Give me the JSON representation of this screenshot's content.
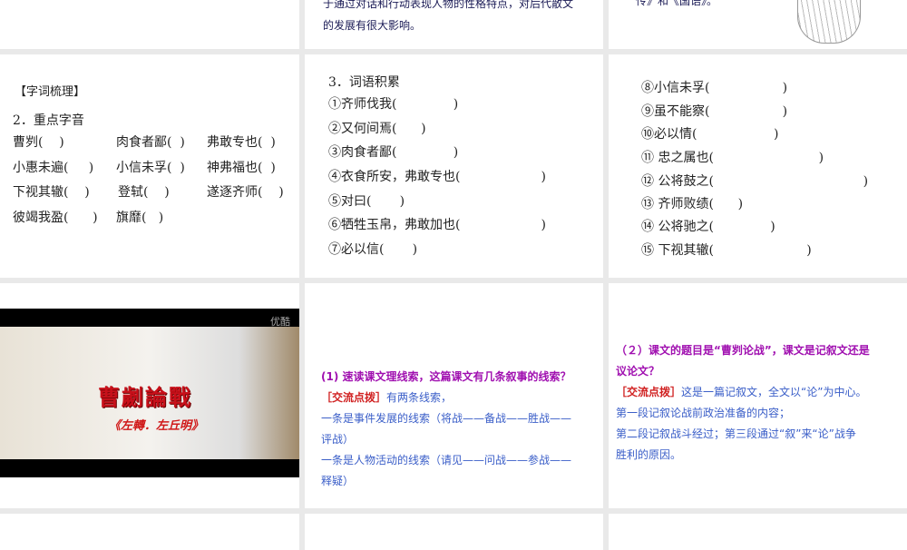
{
  "slides": {
    "s2": {
      "lines": [
        "于通过对话和行动表现人物的性格特点，对后代散文",
        "的发展有很大影响。"
      ]
    },
    "s3": {
      "lines": [
        "传》和《国语》。"
      ]
    },
    "s4": {
      "heading": "【字词梳理】",
      "sub": "2．重点字音",
      "rows": [
        [
          "曹刿(    )",
          "肉食者鄙(  )",
          "弗敢专也(  )"
        ],
        [
          "小惠未遍(     )",
          "小信未孚(  )",
          "神弗福也(  )"
        ],
        [
          "下视其辙(    )",
          "登轼(    )",
          "遂逐齐师(    )"
        ],
        [
          "彼竭我盈(      )",
          "旗靡(   )",
          ""
        ]
      ]
    },
    "s5": {
      "heading": "3．词语积累",
      "items": [
        "①齐师伐我(              )",
        "②又何间焉(      )",
        "③肉食者鄙(              )",
        "④衣食所安，弗敢专也(                    )",
        "⑤对曰(       )",
        "⑥牺牲玉帛，弗敢加也(                    )",
        "⑦必以信(       )"
      ]
    },
    "s6": {
      "items": [
        "⑧小信未孚(                  )",
        "⑨虽不能察(                  )",
        "⑩必以情(                   )",
        "⑪ 忠之属也(                          )",
        "⑫ 公将鼓之(                                     )",
        "⑬ 齐师败绩(      )",
        "⑭ 公将驰之(              )",
        "⑮ 下视其辙(                       )"
      ]
    },
    "s7": {
      "title": "曹劌論戰",
      "subtitle": "《左轉．左丘明》",
      "watermark": "优酷"
    },
    "s8": {
      "question": "(1) 速读课文理线索，这篇课文有几条叙事的线索？",
      "tag": "［交流点拨］",
      "answer": "有两条线索，",
      "l1": "一条是事件发展的线索（将战——备战——胜战——",
      "l2": "评战）",
      "l3": "一条是人物活动的线索（请见——问战——参战——",
      "l4": "释疑）"
    },
    "s9": {
      "q1": "（２）课文的题目是“曹刿论战”，课文是记叙文还是",
      "q2": "议论文？",
      "tag": "［交流点拨］",
      "answer": "这是一篇记叙文，全文以“论”为中心。",
      "l1": "第一段记叙论战前政治准备的内容；",
      "l2": "第二段记叙战斗经过；第三段通过“叙”来“论”战争",
      "l3": "胜利的原因。"
    }
  }
}
